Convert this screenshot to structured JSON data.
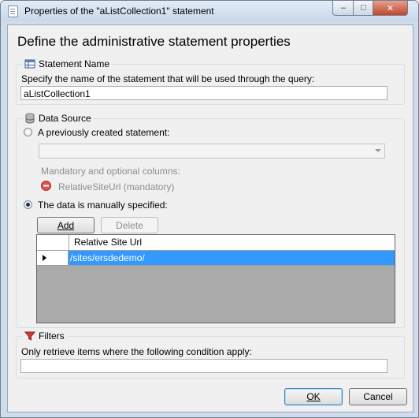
{
  "window": {
    "title": "Properties of the \"aListCollection1\" statement",
    "controls": {
      "minimize": "–",
      "maximize": "□",
      "close": "✕"
    }
  },
  "heading": "Define the administrative statement properties",
  "statement_name": {
    "group_label": "Statement Name",
    "icon": "table-icon",
    "field_label": "Specify the name of the statement that will be used through the query:",
    "value": "aListCollection1"
  },
  "data_source": {
    "group_label": "Data Source",
    "icon": "database-icon",
    "option_previous": "A previously created statement:",
    "previous_selected": false,
    "statement_combo_value": "",
    "columns_label": "Mandatory and optional columns:",
    "mandatory_column": "RelativeSiteUrl (mandatory)",
    "option_manual": "The data is manually specified:",
    "manual_selected": true,
    "add_button": "Add",
    "delete_button": "Delete",
    "grid": {
      "columns": [
        "Relative Site Url"
      ],
      "rows": [
        [
          "/sites/ersdedemo/"
        ]
      ]
    }
  },
  "filters": {
    "group_label": "Filters",
    "icon": "filter-icon",
    "field_label": "Only retrieve items where the following condition apply:",
    "value": ""
  },
  "buttons": {
    "ok": "OK",
    "cancel": "Cancel"
  },
  "colors": {
    "selection": "#3399ff",
    "grid_background": "#aaaaaa",
    "title_bar": "#c7d7ea"
  }
}
